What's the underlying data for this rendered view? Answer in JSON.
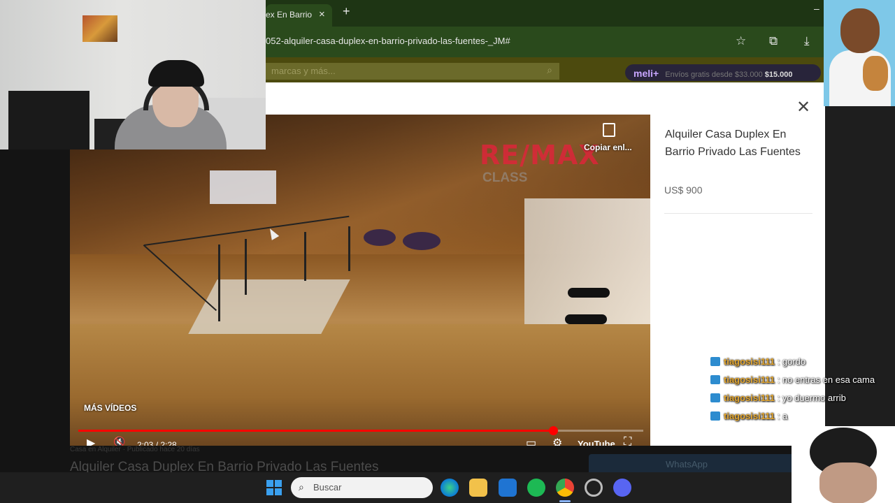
{
  "browser": {
    "tab_title": "ex En Barrio",
    "tab_close": "×",
    "new_tab": "+",
    "minimize": "–",
    "url": "052-alquiler-casa-duplex-en-barrio-privado-las-fuentes-_JM#",
    "bookmark_icon": "☆",
    "extensions_icon": "⧉",
    "download_icon": "⤓"
  },
  "site": {
    "search_placeholder": "marcas y más...",
    "search_icon": "⌕",
    "meli_logo": "meli+",
    "meli_banner_text": "Envíos gratis desde $33.000",
    "meli_price": "$15.000"
  },
  "modal": {
    "close_icon": "✕",
    "listing_title": "Alquiler Casa Duplex En Barrio Privado Las Fuentes",
    "listing_price": "US$ 900"
  },
  "video": {
    "watermark_brand": "RE/MAX",
    "watermark_sub": "CLASS",
    "copy_label": "Copiar enl...",
    "more_videos": "MÁS VÍDEOS",
    "time": "2:03 / 2:28",
    "progress": 0.84,
    "play_icon": "▶",
    "mute_icon": "🔇",
    "settings_icon": "⚙",
    "youtube_label": "YouTube",
    "fullscreen_icon": "⛶",
    "captions_icon": "▭"
  },
  "page": {
    "title": "Alquiler Casa Duplex En Barrio Privado Las Fuentes",
    "caption": "Casa en Alquiler · Publicado hace 20 días",
    "whatsapp": "WhatsApp"
  },
  "chat": [
    {
      "user": "tiagosisi111",
      "message": "gordo"
    },
    {
      "user": "tiagosisi111",
      "message": "no entras en esa cama"
    },
    {
      "user": "tiagosisi111",
      "message": "yo duermo arrib"
    },
    {
      "user": "tiagosisi111",
      "message": "a"
    }
  ],
  "taskbar": {
    "search_placeholder": "Buscar",
    "apps": [
      "edge-icon",
      "files-icon",
      "outlook-icon",
      "spotify-icon",
      "chrome-icon",
      "recorder-icon",
      "discord-icon"
    ]
  },
  "colors": {
    "browser_chrome": "#2a4a1c",
    "youtube_red": "#ff0000",
    "remax_red": "#e2233b",
    "chat_user": "#e6a82f"
  }
}
